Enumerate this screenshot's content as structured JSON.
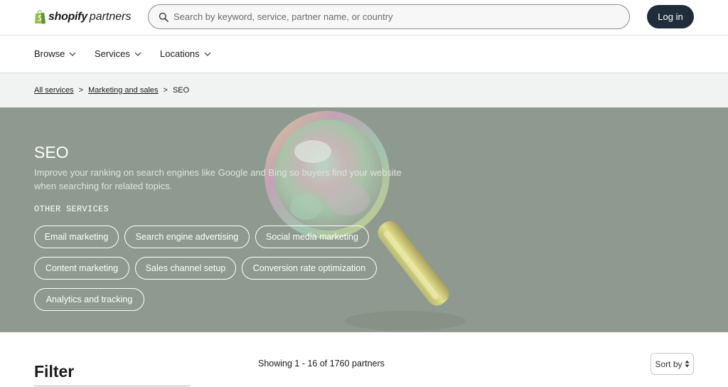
{
  "header": {
    "logo_brand": "shopify",
    "logo_suffix": "partners",
    "search_placeholder": "Search by keyword, service, partner name, or country",
    "login_label": "Log in"
  },
  "nav": {
    "items": [
      {
        "label": "Browse",
        "icon": "chevron-down-icon"
      },
      {
        "label": "Services",
        "icon": "chevron-down-icon"
      },
      {
        "label": "Locations",
        "icon": "chevron-down-icon"
      }
    ]
  },
  "breadcrumb": {
    "items": [
      "All services",
      "Marketing and sales",
      "SEO"
    ],
    "separator": ">"
  },
  "hero": {
    "title": "SEO",
    "description": "Improve your ranking on search engines like Google and Bing so buyers find your website when searching for related topics.",
    "other_label": "OTHER SERVICES",
    "chips": [
      "Email marketing",
      "Search engine advertising",
      "Social media marketing",
      "Content marketing",
      "Sales channel setup",
      "Conversion rate optimization",
      "Analytics and tracking"
    ],
    "illustration_icon": "magnifying-glass-icon"
  },
  "results": {
    "filter_title": "Filter",
    "showing_text": "Showing 1 - 16 of 1760 partners",
    "sort_label": "Sort by"
  },
  "colors": {
    "login_bg": "#1f2d3a",
    "hero_bg": "#8e9a8f",
    "breadcrumb_bg": "#f1f3f2",
    "logo_green": "#95bf47"
  }
}
